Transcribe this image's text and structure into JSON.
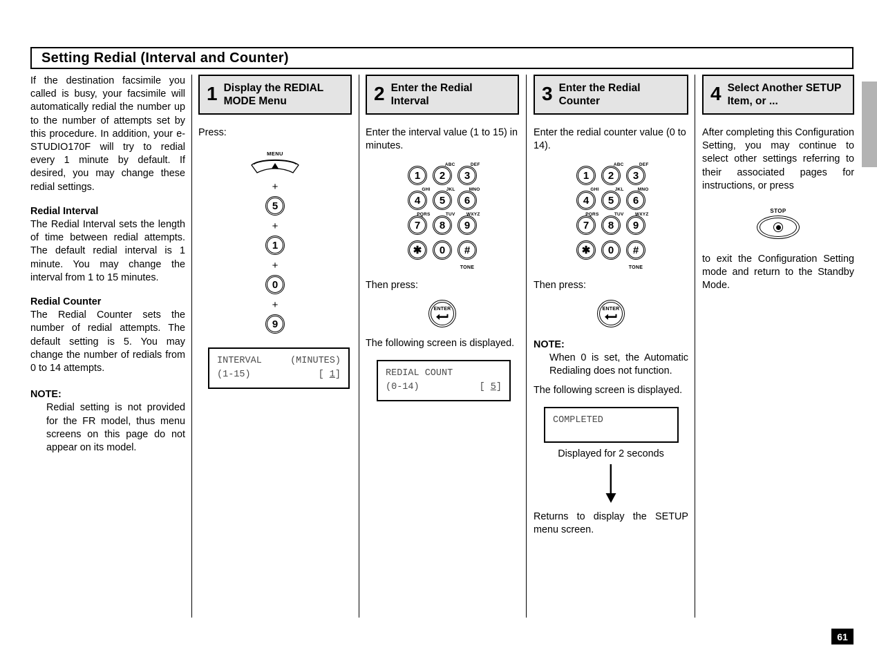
{
  "page": {
    "title": "Setting Redial (Interval and Counter)",
    "number": "61"
  },
  "intro": {
    "paragraph": "If the destination facsimile you called is busy, your facsimile will automatically redial the number up to the number of attempts set by this procedure. In addition, your e-STUDIO170F will try to redial every 1 minute by default. If desired, you may change these redial settings.",
    "section1_heading": "Redial Interval",
    "section1_body": "The Redial Interval sets the length of time between redial attempts. The default redial interval is 1 minute. You may change the interval from 1 to 15 minutes.",
    "section2_heading": "Redial Counter",
    "section2_body": "The Redial Counter sets the number of redial attempts. The default setting is 5. You may change the number of redials from 0 to 14 attempts.",
    "note_heading": "NOTE:",
    "note_body": "Redial setting is not provided for the FR model, thus menu screens on this page do not appear on its model."
  },
  "steps": [
    {
      "number": "1",
      "title": "Display the REDIAL MODE Menu",
      "press_label": "Press:",
      "menu_button_label": "MENU",
      "plus": "+",
      "sequence": [
        "5",
        "1",
        "0",
        "9"
      ],
      "lcd": {
        "line1_left": "INTERVAL",
        "line1_right": "(MINUTES)",
        "line2_left": "(1-15)",
        "line2_right_open": "[ ",
        "line2_value": "1",
        "line2_right_close": "]"
      }
    },
    {
      "number": "2",
      "title": "Enter the Redial Interval",
      "instruction": "Enter the interval value (1 to 15) in minutes.",
      "then_press_label": "Then press:",
      "enter_button_label": "ENTER",
      "after_text": "The following screen is displayed.",
      "lcd": {
        "line1_left": "REDIAL COUNT",
        "line1_right": "",
        "line2_left": "(0-14)",
        "line2_right_open": "[ ",
        "line2_value": "5",
        "line2_right_close": "]"
      }
    },
    {
      "number": "3",
      "title": "Enter the Redial Counter",
      "instruction": "Enter the redial counter value (0 to 14).",
      "then_press_label": "Then press:",
      "enter_button_label": "ENTER",
      "note_heading": "NOTE:",
      "note_body": "When 0 is set, the Automatic Redialing does not function.",
      "after_text": "The following screen is displayed.",
      "lcd": {
        "line1_left": "COMPLETED"
      },
      "lcd_caption": "Displayed for 2 seconds",
      "return_text": "Returns to display the SETUP menu screen."
    },
    {
      "number": "4",
      "title": "Select Another SETUP Item, or ...",
      "paragraph1": "After completing this Configuration Setting, you may continue to select other settings referring to their associated pages for instructions, or press",
      "stop_button_label": "STOP",
      "paragraph2": "to exit the Configuration Setting mode and return to the Standby Mode."
    }
  ],
  "keypad": {
    "keys": [
      {
        "glyph": "1",
        "letters": "",
        "below": ""
      },
      {
        "glyph": "2",
        "letters": "ABC",
        "below": ""
      },
      {
        "glyph": "3",
        "letters": "DEF",
        "below": ""
      },
      {
        "glyph": "4",
        "letters": "GHI",
        "below": ""
      },
      {
        "glyph": "5",
        "letters": "JKL",
        "below": ""
      },
      {
        "glyph": "6",
        "letters": "MNO",
        "below": ""
      },
      {
        "glyph": "7",
        "letters": "PQRS",
        "below": ""
      },
      {
        "glyph": "8",
        "letters": "TUV",
        "below": ""
      },
      {
        "glyph": "9",
        "letters": "WXYZ",
        "below": ""
      },
      {
        "glyph": "✱",
        "letters": "",
        "below": ""
      },
      {
        "glyph": "0",
        "letters": "",
        "below": ""
      },
      {
        "glyph": "#",
        "letters": "",
        "below": "TONE"
      }
    ]
  },
  "colors": {
    "step_box_background": "#e4e4e4",
    "edge_tab": "#b3b3b3",
    "lcd_text": "#4a4a4a",
    "rule": "#000000"
  }
}
